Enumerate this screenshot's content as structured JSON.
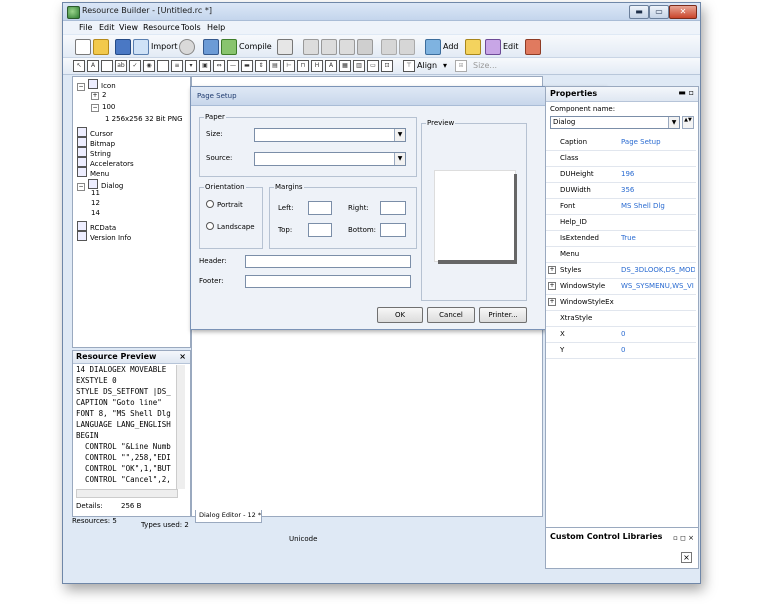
{
  "window": {
    "title": "Resource Builder - [Untitled.rc *]"
  },
  "menubar": [
    "File",
    "Edit",
    "View",
    "Resource",
    "Tools",
    "Help"
  ],
  "toolbar": {
    "import_label": "Import",
    "compile_label": "Compile",
    "add_label": "Add",
    "edit_label": "Edit"
  },
  "toolbar2": {
    "align_label": "Align",
    "size_label": "Size..."
  },
  "tree": {
    "items": [
      {
        "label": "Icon",
        "level": 0,
        "expander": "−"
      },
      {
        "label": "2",
        "level": 1,
        "expander": "+"
      },
      {
        "label": "100",
        "level": 1,
        "expander": "−"
      },
      {
        "label": "1 256x256 32 Bit PNG",
        "level": 2,
        "expander": ""
      },
      {
        "label": "Cursor",
        "level": 0,
        "expander": ""
      },
      {
        "label": "Bitmap",
        "level": 0,
        "expander": ""
      },
      {
        "label": "String",
        "level": 0,
        "expander": ""
      },
      {
        "label": "Accelerators",
        "level": 0,
        "expander": ""
      },
      {
        "label": "Menu",
        "level": 0,
        "expander": ""
      },
      {
        "label": "Dialog",
        "level": 0,
        "expander": "−"
      },
      {
        "label": "11",
        "level": 1,
        "expander": ""
      },
      {
        "label": "12",
        "level": 1,
        "expander": ""
      },
      {
        "label": "14",
        "level": 1,
        "expander": ""
      },
      {
        "label": "RCData",
        "level": 0,
        "expander": ""
      },
      {
        "label": "Version Info",
        "level": 0,
        "expander": ""
      }
    ]
  },
  "resource_preview": {
    "title": "Resource Preview",
    "lines": [
      "14 DIALOGEX MOVEABLE",
      "EXSTYLE 0",
      "STYLE DS_SETFONT |DS_",
      "CAPTION \"Goto line\"",
      "FONT 8, \"MS Shell Dlg",
      "LANGUAGE LANG_ENGLISH",
      "BEGIN",
      "  CONTROL \"&Line Numb",
      "  CONTROL \"\",258,\"EDI",
      "  CONTROL \"OK\",1,\"BUT",
      "  CONTROL \"Cancel\",2,"
    ],
    "details_label": "Details:",
    "details_value": "256 B"
  },
  "dialog": {
    "title": "Page Setup",
    "paper_group": "Paper",
    "size_label": "Size:",
    "source_label": "Source:",
    "orientation_group": "Orientation",
    "portrait_label": "Portrait",
    "landscape_label": "Landscape",
    "margins_group": "Margins",
    "left_label": "Left:",
    "right_label": "Right:",
    "top_label": "Top:",
    "bottom_label": "Bottom:",
    "header_label": "Header:",
    "footer_label": "Footer:",
    "preview_group": "Preview",
    "ok_label": "OK",
    "cancel_label": "Cancel",
    "printer_label": "Printer..."
  },
  "editor_tab": "Dialog Editor - 12 *",
  "properties": {
    "title": "Properties",
    "component_label": "Component name:",
    "component_value": "Dialog",
    "rows": [
      {
        "name": "Caption",
        "value": "Page Setup",
        "exp": ""
      },
      {
        "name": "Class",
        "value": "",
        "exp": ""
      },
      {
        "name": "DUHeight",
        "value": "196",
        "exp": ""
      },
      {
        "name": "DUWidth",
        "value": "356",
        "exp": ""
      },
      {
        "name": "Font",
        "value": "MS Shell Dlg",
        "exp": ""
      },
      {
        "name": "Help_ID",
        "value": "",
        "exp": ""
      },
      {
        "name": "IsExtended",
        "value": "True",
        "exp": ""
      },
      {
        "name": "Menu",
        "value": "",
        "exp": ""
      },
      {
        "name": "Styles",
        "value": "DS_3DLOOK,DS_MOD",
        "exp": "+"
      },
      {
        "name": "WindowStyle",
        "value": "WS_SYSMENU,WS_VI",
        "exp": "+"
      },
      {
        "name": "WindowStyleEx",
        "value": "",
        "exp": "+"
      },
      {
        "name": "XtraStyle",
        "value": "",
        "exp": ""
      },
      {
        "name": "X",
        "value": "0",
        "exp": ""
      },
      {
        "name": "Y",
        "value": "0",
        "exp": ""
      }
    ]
  },
  "custom_controls": {
    "title": "Custom Control Libraries"
  },
  "status": {
    "resources": "Resources: 5",
    "types": "Types used: 2",
    "encoding": "Unicode"
  }
}
